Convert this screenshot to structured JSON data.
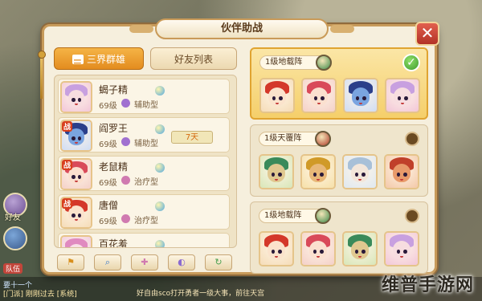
{
  "dialog": {
    "title": "伙伴助战",
    "close_symbol": "✕"
  },
  "tabs": {
    "active_label": "三界群雄",
    "inactive_label": "好友列表"
  },
  "heroes": [
    {
      "name": "蝎子精",
      "level": "69级",
      "role": "辅助型",
      "battle": "",
      "days": "",
      "colors": {
        "bg": "#f2c6d8",
        "hair": "#c8a0e0",
        "skin": "#f7dde0",
        "role": "#a070d0"
      }
    },
    {
      "name": "阎罗王",
      "level": "69级",
      "role": "辅助型",
      "battle": "战",
      "days": "7天",
      "colors": {
        "bg": "#cfdcf3",
        "hair": "#2b3f8a",
        "skin": "#7aa4e0",
        "role": "#a070d0"
      }
    },
    {
      "name": "老鼠精",
      "level": "69级",
      "role": "治疗型",
      "battle": "战",
      "days": "",
      "colors": {
        "bg": "#f4d0c8",
        "hair": "#d94a5a",
        "skin": "#fbe0cf",
        "role": "#d07ab0"
      }
    },
    {
      "name": "唐僧",
      "level": "69级",
      "role": "治疗型",
      "battle": "战",
      "days": "",
      "colors": {
        "bg": "#f5dcb8",
        "hair": "#d4382a",
        "skin": "#fbe3cc",
        "role": "#d07ab0"
      }
    },
    {
      "name": "百花羞",
      "level": "",
      "role": "",
      "battle": "",
      "days": "",
      "colors": {
        "bg": "#f0c8e0",
        "hair": "#e08ac0",
        "skin": "#f9e0e6",
        "role": "#d07ab0"
      }
    }
  ],
  "filters": [
    "a",
    "b",
    "c",
    "d",
    "e"
  ],
  "filter_icons": [
    "flag-icon",
    "search-icon",
    "heal-icon",
    "support-icon",
    "refresh-icon"
  ],
  "formations": [
    {
      "label": "1级地载阵",
      "state": "selected",
      "badge_color": "#3d8a4a",
      "slots": [
        {
          "bg": "#f5dcb8",
          "hair": "#d4382a",
          "skin": "#fbe3cc"
        },
        {
          "bg": "#f4d0c8",
          "hair": "#d94a5a",
          "skin": "#fbe0cf"
        },
        {
          "bg": "#cfdcf3",
          "hair": "#2b3f8a",
          "skin": "#7aa4e0"
        },
        {
          "bg": "#f2c6d8",
          "hair": "#c8a0e0",
          "skin": "#f7dde0"
        }
      ]
    },
    {
      "label": "1级天覆阵",
      "state": "unselected",
      "badge_color": "#b03a2a",
      "slots": [
        {
          "bg": "#d8e6b8",
          "hair": "#3a8a5a",
          "skin": "#e0c890"
        },
        {
          "bg": "#f6e0a8",
          "hair": "#d09a28",
          "skin": "#e8b878"
        },
        {
          "bg": "#dfe8f0",
          "hair": "#a8c0d8",
          "skin": "#f3e6da"
        },
        {
          "bg": "#f3c8a8",
          "hair": "#c0402a",
          "skin": "#e89a6a"
        }
      ]
    },
    {
      "label": "1级地载阵",
      "state": "unselected",
      "badge_color": "#3d8a4a",
      "slots": [
        {
          "bg": "#f5dcb8",
          "hair": "#d4382a",
          "skin": "#fbe3cc"
        },
        {
          "bg": "#f4d0c8",
          "hair": "#d94a5a",
          "skin": "#fbe0cf"
        },
        {
          "bg": "#d8e6b8",
          "hair": "#3a8a5a",
          "skin": "#e0c890"
        },
        {
          "bg": "#f2c6d8",
          "hair": "#c8a0e0",
          "skin": "#f7dde0"
        }
      ]
    }
  ],
  "world": {
    "side_label": "好友",
    "chat_tag": "队伍",
    "chat_line_1": "要十一个",
    "chat_line_2": "[门派] 刚刚过去 [系统]",
    "chat_center": "好自由sco打开勇者一级大事，前往天宫",
    "watermark": "维普手游网"
  },
  "colors": {
    "accent": "#e38c1f",
    "panel": "#f6efdd",
    "border": "#c79a5a",
    "close": "#b23226"
  }
}
